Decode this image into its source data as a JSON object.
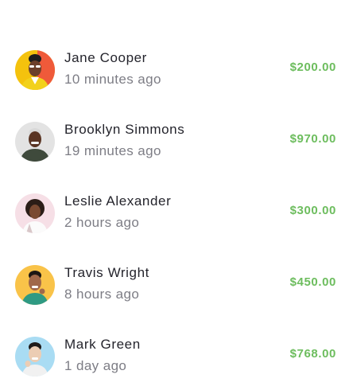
{
  "transactions": [
    {
      "name": "Jane Cooper",
      "time": "10 minutes ago",
      "amount": "$200.00",
      "avatar_icon": "person-yellow-background-avatar"
    },
    {
      "name": "Brooklyn Simmons",
      "time": "19 minutes ago",
      "amount": "$970.00",
      "avatar_icon": "person-gray-background-avatar"
    },
    {
      "name": "Leslie Alexander",
      "time": "2 hours ago",
      "amount": "$300.00",
      "avatar_icon": "person-pink-background-avatar"
    },
    {
      "name": "Travis Wright",
      "time": "8 hours ago",
      "amount": "$450.00",
      "avatar_icon": "person-orange-background-avatar"
    },
    {
      "name": "Mark Green",
      "time": "1 day ago",
      "amount": "$768.00",
      "avatar_icon": "person-blue-background-avatar"
    }
  ],
  "colors": {
    "amount": "#6dbd5e",
    "name": "#24242c",
    "time": "#7d7d85"
  }
}
